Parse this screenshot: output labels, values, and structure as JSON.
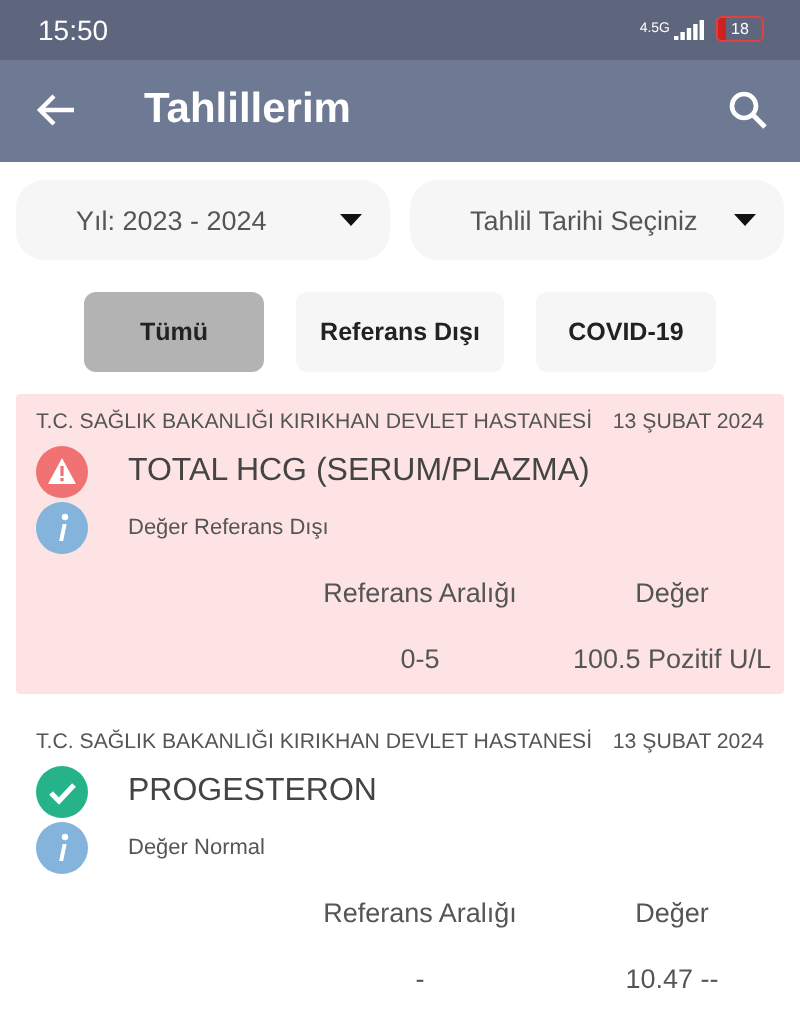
{
  "status_bar": {
    "time": "15:50",
    "network": "4.5G",
    "battery": "18"
  },
  "app_bar": {
    "title": "Tahlillerim"
  },
  "filters": [
    {
      "label": "Yıl: 2023 - 2024"
    },
    {
      "label": "Tahlil Tarihi Seçiniz"
    }
  ],
  "tabs": [
    {
      "label": "Tümü",
      "selected": true
    },
    {
      "label": "Referans Dışı",
      "selected": false
    },
    {
      "label": "COVID-19",
      "selected": false
    }
  ],
  "results": [
    {
      "kind": "out_of_range",
      "hospital": "T.C. SAĞLIK BAKANLIĞI KIRIKHAN DEVLET HASTANESİ",
      "date": "13 ŞUBAT 2024",
      "test": "TOTAL HCG (SERUM/PLAZMA)",
      "status": "Değer Referans Dışı",
      "range_header": "Referans Aralığı",
      "value_header": "Değer",
      "range": "0-5",
      "value": "100.5 Pozitif U/L"
    },
    {
      "kind": "normal",
      "hospital": "T.C. SAĞLIK BAKANLIĞI KIRIKHAN DEVLET HASTANESİ",
      "date": "13 ŞUBAT 2024",
      "test": "PROGESTERON",
      "status": "Değer Normal",
      "range_header": "Referans Aralığı",
      "value_header": "Değer",
      "range": "-",
      "value": "10.47 --"
    }
  ]
}
